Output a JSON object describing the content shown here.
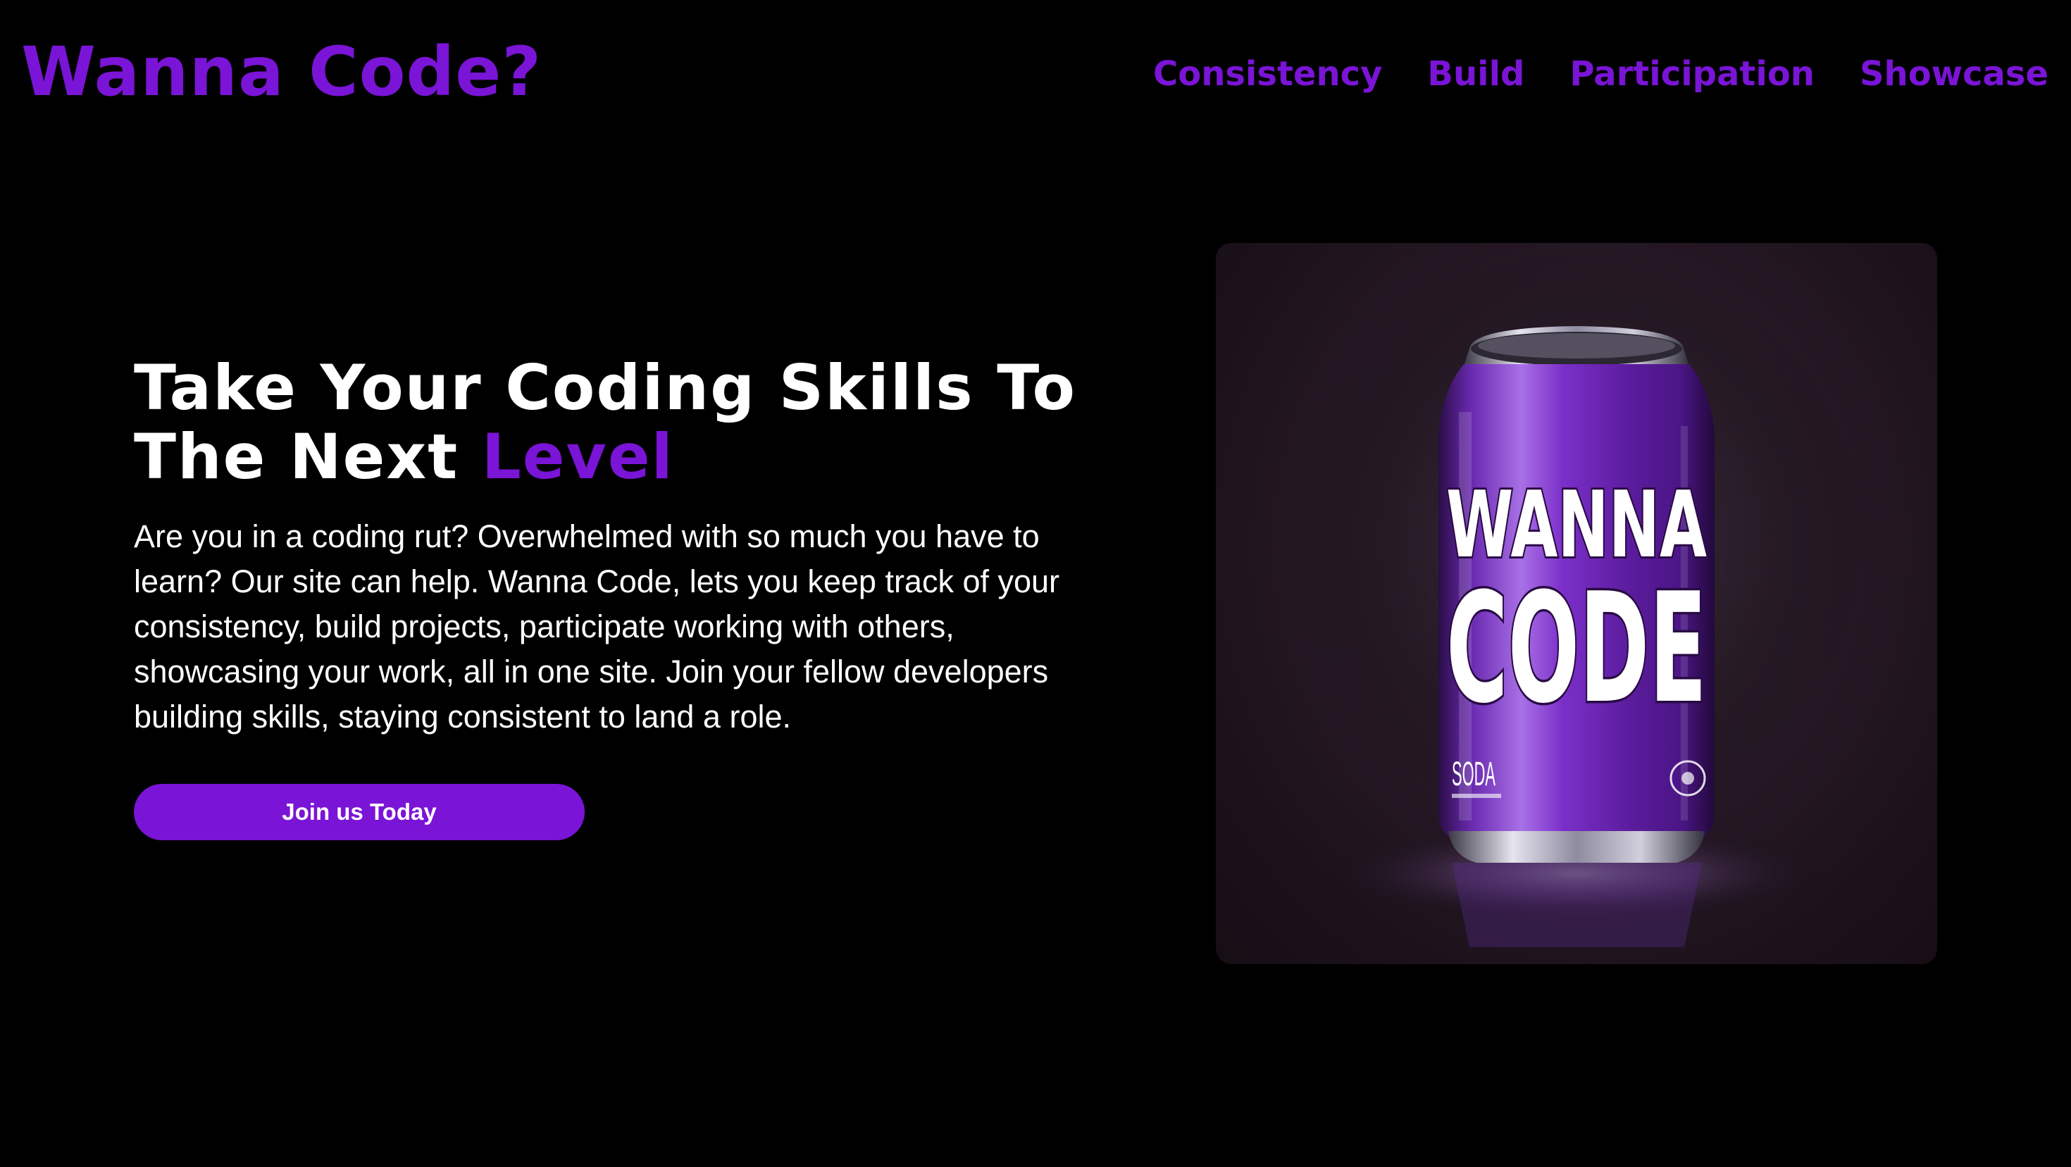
{
  "header": {
    "logo": "Wanna Code?",
    "nav": [
      {
        "label": "Consistency"
      },
      {
        "label": "Build"
      },
      {
        "label": "Participation"
      },
      {
        "label": "Showcase"
      }
    ]
  },
  "hero": {
    "title_line1": "Take Your Coding Skills To",
    "title_line2_prefix": "The Next ",
    "title_line2_accent": "Level",
    "description": "Are you in a coding rut? Overwhelmed with so much you have to learn? Our site can help. Wanna Code, lets you keep track of your consistency, build projects, participate working with others, showcasing your work, all in one site. Join your fellow developers building skills, staying consistent to land a role.",
    "cta_label": "Join us Today"
  },
  "can": {
    "line1": "WANNA",
    "line2": "CODE",
    "label": "SODA"
  },
  "colors": {
    "accent": "#7a14d6",
    "background": "#000000",
    "text": "#ffffff"
  }
}
